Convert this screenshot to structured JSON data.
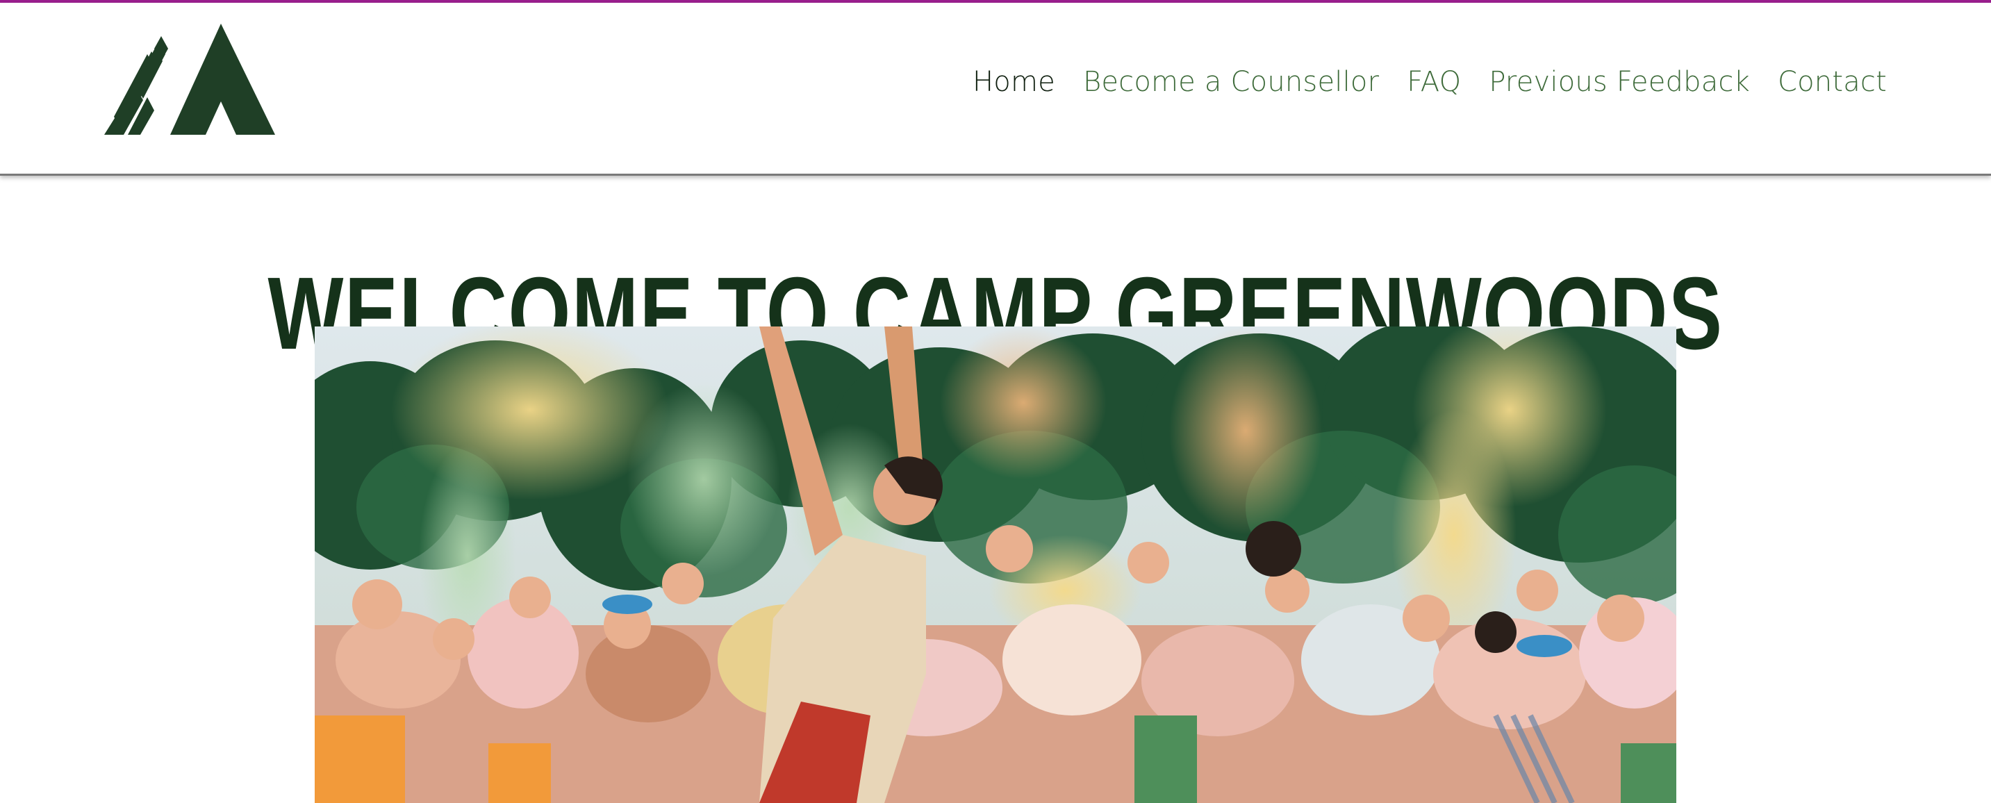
{
  "header": {
    "logo": {
      "icon": "tent-mountain-logo-icon",
      "color": "#1f3f26"
    },
    "accent_color": "#9b1f8e",
    "nav": [
      {
        "label": "Home",
        "active": true
      },
      {
        "label": "Become a Counsellor",
        "active": false
      },
      {
        "label": "FAQ",
        "active": false
      },
      {
        "label": "Previous Feedback",
        "active": false
      },
      {
        "label": "Contact",
        "active": false
      }
    ]
  },
  "main": {
    "title": "WELCOME TO CAMP GREENWOODS",
    "hero_image": {
      "icon": "camp-color-festival-photo"
    }
  },
  "colors": {
    "nav_text": "#3e6b3a",
    "nav_active": "#0f1f0f",
    "title": "#15321a"
  }
}
